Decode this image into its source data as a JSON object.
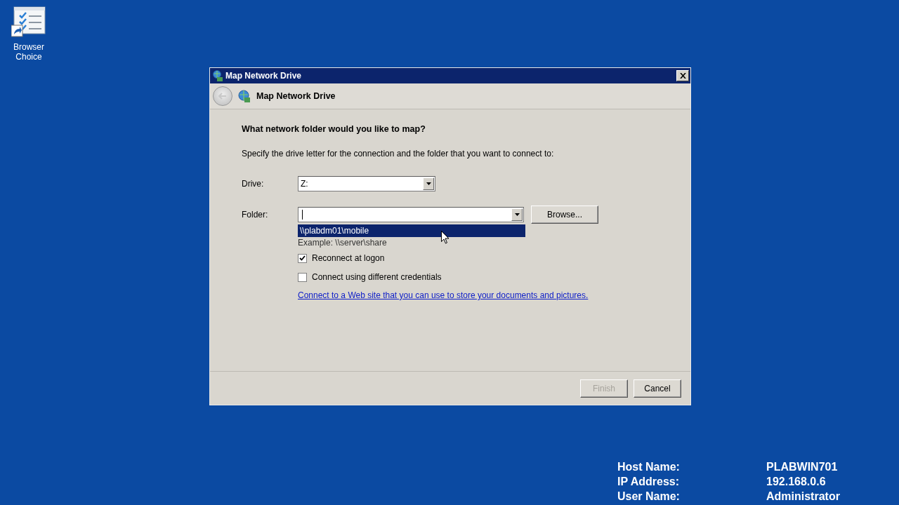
{
  "desktop_icons": [
    {
      "label": "Browser Choice"
    }
  ],
  "dialog": {
    "title": "Map Network Drive",
    "header": "Map Network Drive",
    "heading": "What network folder would you like to map?",
    "instruction": "Specify the drive letter for the connection and the folder that you want to connect to:",
    "drive": {
      "label": "Drive:",
      "value": "Z:"
    },
    "folder": {
      "label": "Folder:",
      "focused": true
    },
    "browse_button": "Browse...",
    "folder_suggestions": [
      {
        "text": "\\\\plabdm01\\mobile",
        "selected": true
      }
    ],
    "example": "Example: \\\\server\\share",
    "options": [
      {
        "label": "Reconnect at logon",
        "checked": true
      },
      {
        "label": "Connect using different credentials",
        "checked": false
      }
    ],
    "link": "Connect to a Web site that you can use to store your documents and pictures.",
    "buttons": [
      {
        "label": "Finish",
        "disabled": true
      },
      {
        "label": "Cancel",
        "disabled": false
      }
    ]
  },
  "system_info": [
    {
      "label": "Host Name:",
      "value": "PLABWIN701"
    },
    {
      "label": "IP Address:",
      "value": "192.168.0.6"
    },
    {
      "label": "User Name:",
      "value": "Administrator"
    }
  ]
}
